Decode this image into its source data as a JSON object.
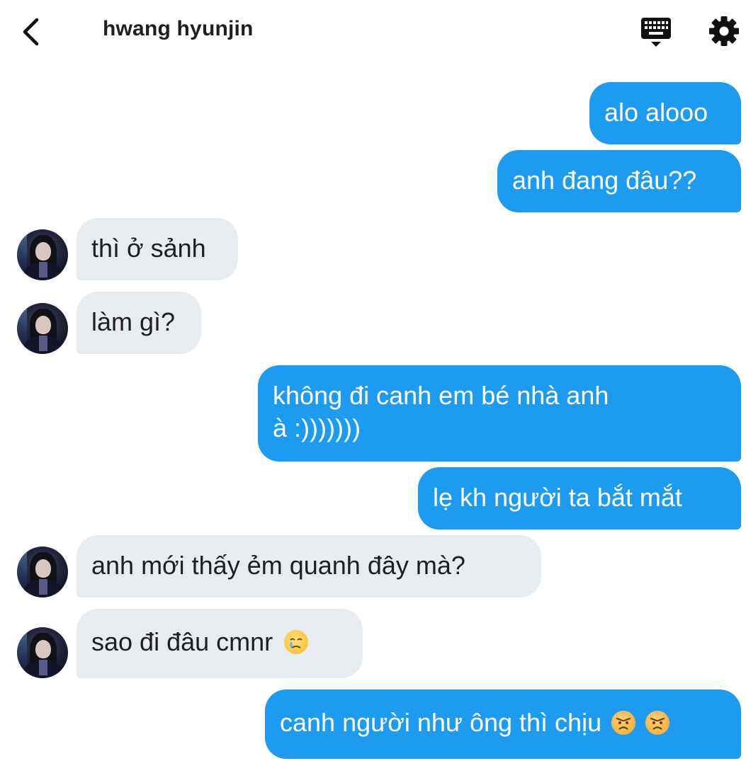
{
  "header": {
    "title": "hwang hyunjin",
    "back_icon": "chevron-left-icon",
    "keyboard_icon": "keyboard-icon",
    "settings_icon": "gear-icon"
  },
  "colors": {
    "sent_bubble": "#1d9bf0",
    "received_bubble": "#e8ecf0",
    "sent_text": "#ffffff",
    "received_text": "#1f1f1f"
  },
  "messages": [
    {
      "side": "sent",
      "text": "alo alooo"
    },
    {
      "side": "sent",
      "text": "anh đang đâu??"
    },
    {
      "side": "received",
      "text": "thì ở sảnh"
    },
    {
      "side": "received",
      "text": "làm gì?"
    },
    {
      "side": "sent",
      "lines": [
        "không đi canh em bé nhà anh",
        "à :)))))))"
      ]
    },
    {
      "side": "sent",
      "text": "lẹ kh người ta bắt mắt"
    },
    {
      "side": "received",
      "text": "anh mới thấy ẻm quanh đây mà?"
    },
    {
      "side": "received",
      "text": "sao đi đâu cmnr",
      "emoji": [
        "face-holding-back-tears-emoji"
      ]
    },
    {
      "side": "sent",
      "text": "canh người như ông thì chịu",
      "emoji": [
        "angry-face-emoji",
        "angry-face-emoji"
      ]
    }
  ]
}
